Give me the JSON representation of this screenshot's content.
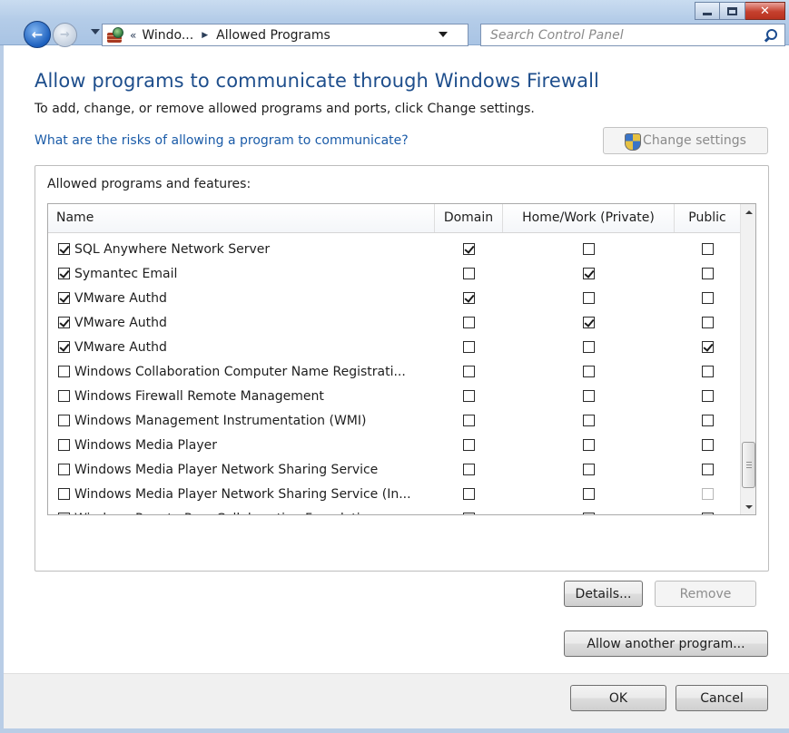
{
  "window": {
    "caption_buttons": [
      "minimize",
      "maximize",
      "close"
    ]
  },
  "address_bar": {
    "overflow_chevron": "«",
    "crumb1": "Windo...",
    "crumb2": "Allowed Programs",
    "search_placeholder": "Search Control Panel"
  },
  "page": {
    "title": "Allow programs to communicate through Windows Firewall",
    "description": "To add, change, or remove allowed programs and ports, click Change settings.",
    "risk_link": "What are the risks of allowing a program to communicate?",
    "change_settings_label": "Change settings"
  },
  "group": {
    "label": "Allowed programs and features:"
  },
  "table": {
    "columns": [
      "Name",
      "Domain",
      "Home/Work (Private)",
      "Public"
    ],
    "rows": [
      {
        "name": "SQL Anywhere Network Server",
        "enabled": true,
        "domain": true,
        "home": false,
        "public": false
      },
      {
        "name": "Symantec Email",
        "enabled": true,
        "domain": false,
        "home": true,
        "public": false
      },
      {
        "name": "VMware Authd",
        "enabled": true,
        "domain": true,
        "home": false,
        "public": false
      },
      {
        "name": "VMware Authd",
        "enabled": true,
        "domain": false,
        "home": true,
        "public": false
      },
      {
        "name": "VMware Authd",
        "enabled": true,
        "domain": false,
        "home": false,
        "public": true
      },
      {
        "name": "Windows Collaboration Computer Name Registrati...",
        "enabled": false,
        "domain": false,
        "home": false,
        "public": false
      },
      {
        "name": "Windows Firewall Remote Management",
        "enabled": false,
        "domain": false,
        "home": false,
        "public": false
      },
      {
        "name": "Windows Management Instrumentation (WMI)",
        "enabled": false,
        "domain": false,
        "home": false,
        "public": false
      },
      {
        "name": "Windows Media Player",
        "enabled": false,
        "domain": false,
        "home": false,
        "public": false
      },
      {
        "name": "Windows Media Player Network Sharing Service",
        "enabled": false,
        "domain": false,
        "home": false,
        "public": false
      },
      {
        "name": "Windows Media Player Network Sharing Service (In...",
        "enabled": false,
        "domain": false,
        "home": false,
        "public": false,
        "public_dim": true
      },
      {
        "name": "Windows Peer to Peer Collaboration Foundation",
        "enabled": false,
        "domain": false,
        "home": false,
        "public": false
      }
    ]
  },
  "buttons": {
    "details": "Details...",
    "remove": "Remove",
    "allow_another": "Allow another program...",
    "ok": "OK",
    "cancel": "Cancel"
  },
  "colors": {
    "title": "#1e4e8c",
    "link": "#1a5ba8",
    "close_button": "#c5402e"
  }
}
